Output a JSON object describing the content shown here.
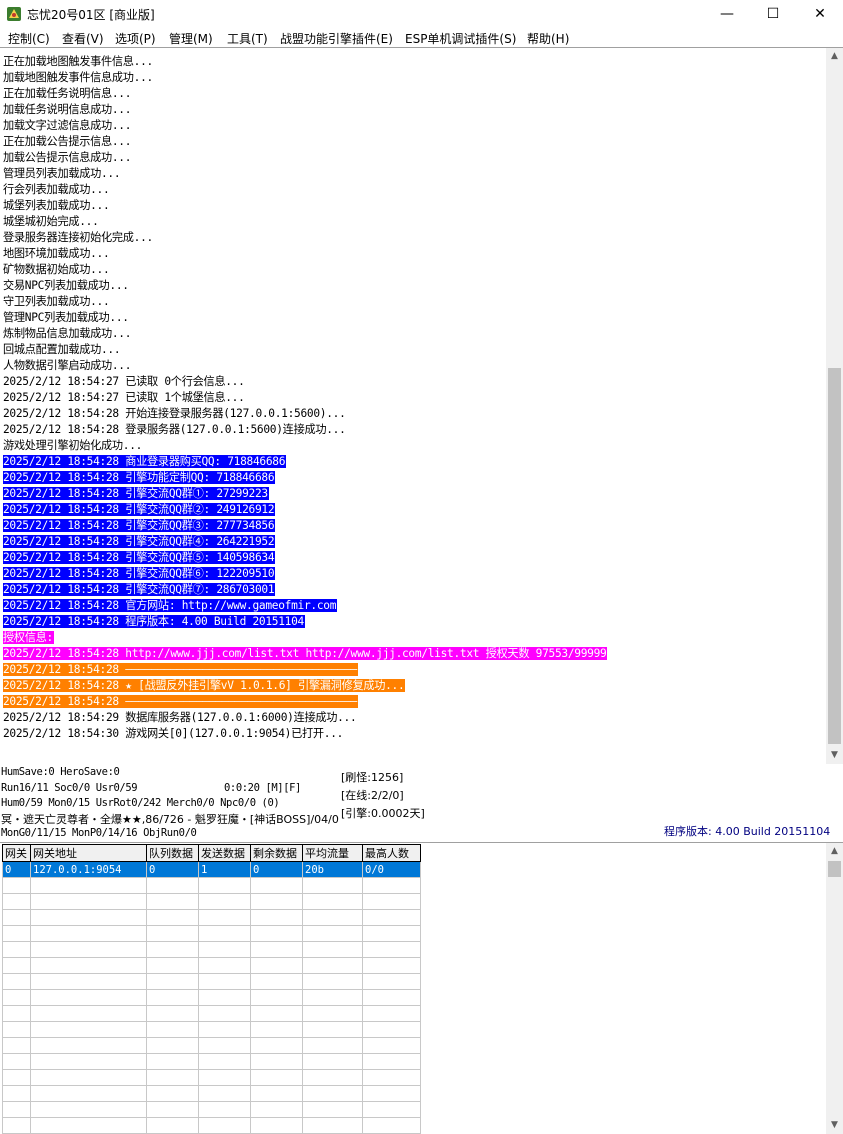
{
  "window": {
    "title": "忘忧20号01区 [商业版]",
    "minimize_glyph": "—",
    "maximize_glyph": "☐",
    "close_glyph": "✕",
    "icon": "app-icon"
  },
  "menu": [
    "控制(C)",
    "查看(V)",
    "选项(P)",
    "管理(M)",
    "工具(T)",
    "战盟功能引擎插件(E)",
    "ESP单机调试插件(S)",
    "帮助(H)"
  ],
  "log": [
    {
      "text": "正在加载地图触发事件信息...",
      "style": ""
    },
    {
      "text": "加载地图触发事件信息成功...",
      "style": ""
    },
    {
      "text": "正在加载任务说明信息...",
      "style": ""
    },
    {
      "text": "加载任务说明信息成功...",
      "style": ""
    },
    {
      "text": "加载文字过滤信息成功...",
      "style": ""
    },
    {
      "text": "正在加载公告提示信息...",
      "style": ""
    },
    {
      "text": "加载公告提示信息成功...",
      "style": ""
    },
    {
      "text": "管理员列表加载成功...",
      "style": ""
    },
    {
      "text": "行会列表加载成功...",
      "style": ""
    },
    {
      "text": "城堡列表加载成功...",
      "style": ""
    },
    {
      "text": "城堡城初始完成...",
      "style": ""
    },
    {
      "text": "登录服务器连接初始化完成...",
      "style": ""
    },
    {
      "text": "地图环境加载成功...",
      "style": ""
    },
    {
      "text": "矿物数据初始成功...",
      "style": ""
    },
    {
      "text": "交易NPC列表加载成功...",
      "style": ""
    },
    {
      "text": "守卫列表加载成功...",
      "style": ""
    },
    {
      "text": "管理NPC列表加载成功...",
      "style": ""
    },
    {
      "text": "炼制物品信息加载成功...",
      "style": ""
    },
    {
      "text": "回城点配置加载成功...",
      "style": ""
    },
    {
      "text": "人物数据引擎启动成功...",
      "style": ""
    },
    {
      "text": "2025/2/12 18:54:27 已读取 0个行会信息...",
      "style": ""
    },
    {
      "text": "2025/2/12 18:54:27 已读取 1个城堡信息...",
      "style": ""
    },
    {
      "text": "2025/2/12 18:54:28 开始连接登录服务器(127.0.0.1:5600)...",
      "style": ""
    },
    {
      "text": "2025/2/12 18:54:28 登录服务器(127.0.0.1:5600)连接成功...",
      "style": ""
    },
    {
      "text": "游戏处理引擎初始化成功...",
      "style": ""
    },
    {
      "text": "2025/2/12 18:54:28 商业登录器购买QQ: 718846686",
      "style": "blue"
    },
    {
      "text": "2025/2/12 18:54:28 引擎功能定制QQ: 718846686",
      "style": "blue"
    },
    {
      "text": "2025/2/12 18:54:28 引擎交流QQ群①: 27299223",
      "style": "blue"
    },
    {
      "text": "2025/2/12 18:54:28 引擎交流QQ群②: 249126912",
      "style": "blue"
    },
    {
      "text": "2025/2/12 18:54:28 引擎交流QQ群③: 277734856",
      "style": "blue"
    },
    {
      "text": "2025/2/12 18:54:28 引擎交流QQ群④: 264221952",
      "style": "blue"
    },
    {
      "text": "2025/2/12 18:54:28 引擎交流QQ群⑤: 140598634",
      "style": "blue"
    },
    {
      "text": "2025/2/12 18:54:28 引擎交流QQ群⑥: 122209510",
      "style": "blue"
    },
    {
      "text": "2025/2/12 18:54:28 引擎交流QQ群⑦: 286703001",
      "style": "blue"
    },
    {
      "text": "2025/2/12 18:54:28 官方网站: http://www.gameofmir.com",
      "style": "blue"
    },
    {
      "text": "2025/2/12 18:54:28 程序版本: 4.00 Build 20151104",
      "style": "blue"
    },
    {
      "text": "授权信息:",
      "style": "magenta"
    },
    {
      "text": "2025/2/12 18:54:28 http://www.jjj.com/list.txt http://www.jjj.com/list.txt 授权天数 97553/99999",
      "style": "magenta"
    },
    {
      "text": "2025/2/12 18:54:28 ————————————————————————————————————",
      "style": "orange"
    },
    {
      "text": "2025/2/12 18:54:28 ★ [战盟反外挂引擎vV 1.0.1.6] 引擎漏洞修复成功...",
      "style": "orange"
    },
    {
      "text": "2025/2/12 18:54:28 ————————————————————————————————————",
      "style": "orange"
    },
    {
      "text": "2025/2/12 18:54:29 数据库服务器(127.0.0.1:6000)连接成功...",
      "style": ""
    },
    {
      "text": "2025/2/12 18:54:30 游戏网关[0](127.0.0.1:9054)已打开...",
      "style": ""
    }
  ],
  "status": {
    "line1": "HumSave:0 HeroSave:0",
    "line2": "Run16/11 Soc0/0 Usr0/59",
    "timer": "0:0:20 [M][F]",
    "line3": "Hum0/59 Mon0/15 UsrRot0/242 Merch0/0 Npc0/0 (0)",
    "boss_line": "冥・遮天亡灵尊者・全爆★★,86/726 - 魁罗狂魔・[神话BOSS]/04/0",
    "line5": "MonG0/11/15 MonP0/14/16 ObjRun0/0",
    "refresh": "[刷怪:1256]",
    "online": "[在线:2/2/0]",
    "engine": "[引擎:0.0002天]",
    "version": "程序版本: 4.00 Build 20151104"
  },
  "grid": {
    "headers": [
      "网关",
      "网关地址",
      "队列数据",
      "发送数据",
      "剩余数据",
      "平均流量",
      "最高人数"
    ],
    "rows": [
      [
        "0",
        "127.0.0.1:9054",
        "0",
        "1",
        "0",
        "20b",
        "0/0"
      ]
    ],
    "empty_rows": 16
  }
}
